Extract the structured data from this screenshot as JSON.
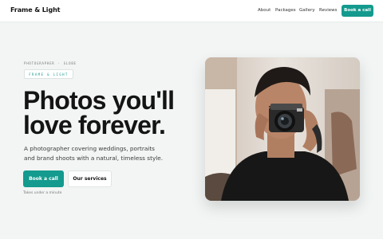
{
  "brand": {
    "name": "Frame & Light"
  },
  "nav": {
    "links": [
      {
        "label": "About"
      },
      {
        "label": "Packages"
      },
      {
        "label": "Gallery"
      },
      {
        "label": "Reviews"
      }
    ],
    "cta_label": "Book a call"
  },
  "hero": {
    "eyebrow_left": "PHOTOGRAPHER",
    "eyebrow_sep": "·",
    "eyebrow_right": "GLOBE",
    "chip": "FRAME & LIGHT",
    "headline_line1": "Photos you'll",
    "headline_line2": "love forever.",
    "subtitle": "A photographer covering weddings, portraits and brand shoots with a natural, timeless style.",
    "primary_cta": "Book a call",
    "secondary_cta": "Our services",
    "hint": "Takes under a minute"
  },
  "colors": {
    "accent": "#149a8e",
    "background": "#f2f5f4",
    "text": "#141414"
  },
  "icons": [
    "hero-photo-photographer-with-camera"
  ]
}
